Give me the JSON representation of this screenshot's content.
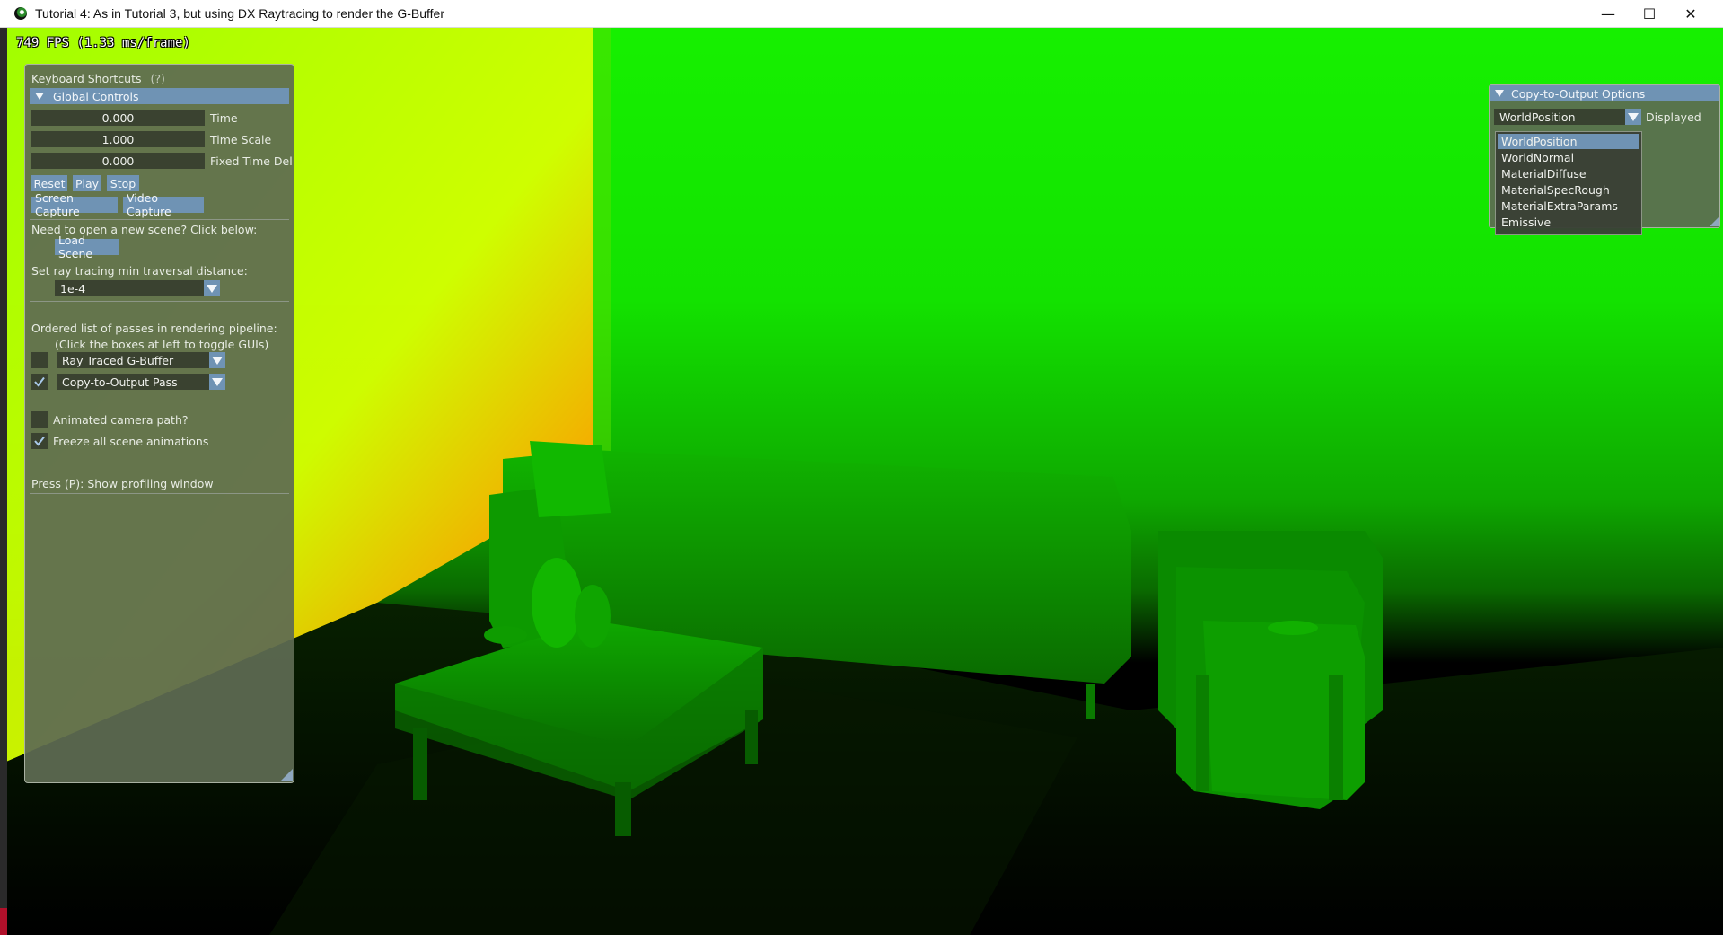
{
  "window": {
    "title": "Tutorial 4:  As in Tutorial 3, but using DX Raytracing to render the G-Buffer",
    "controls": {
      "minimize": "—",
      "maximize": "☐",
      "close": "✕"
    }
  },
  "fps_text": "749 FPS (1.33 ms/frame)",
  "main_panel": {
    "header": "Keyboard Shortcuts",
    "header_help": "(?)",
    "section": "Global Controls",
    "time": {
      "value": "0.000",
      "label": "Time"
    },
    "time_scale": {
      "value": "1.000",
      "label": "Time Scale"
    },
    "fixed_time_delta": {
      "value": "0.000",
      "label": "Fixed Time Delt"
    },
    "buttons": {
      "reset": "Reset",
      "play": "Play",
      "stop": "Stop",
      "screen_capture": "Screen Capture",
      "video_capture": "Video Capture"
    },
    "scene_prompt": "Need to open a new scene?  Click below:",
    "load_scene": "Load Scene",
    "min_traversal_label": "Set ray tracing min traversal distance:",
    "min_traversal_value": "1e-4",
    "passes_label": "Ordered list of passes in rendering pipeline:",
    "passes_hint": "(Click the boxes at left to toggle GUIs)",
    "passes": [
      {
        "name": "Ray Traced G-Buffer",
        "checked": false
      },
      {
        "name": "Copy-to-Output Pass",
        "checked": true
      }
    ],
    "animated_camera": {
      "label": "Animated camera path?",
      "checked": false
    },
    "freeze_animations": {
      "label": "Freeze all scene animations",
      "checked": true
    },
    "profiling_hint": "Press (P):  Show profiling window"
  },
  "output_panel": {
    "header": "Copy-to-Output Options",
    "selected": "WorldPosition",
    "displayed_label": "Displayed",
    "options": [
      "WorldPosition",
      "WorldNormal",
      "MaterialDiffuse",
      "MaterialSpecRough",
      "MaterialExtraParams",
      "Emissive"
    ]
  }
}
